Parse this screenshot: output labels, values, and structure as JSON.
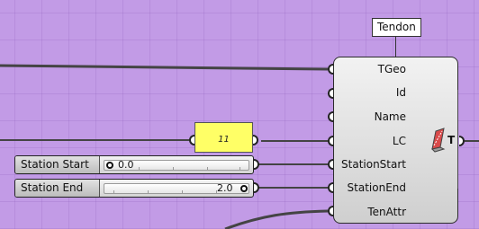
{
  "tooltip": {
    "text": "Tendon"
  },
  "component": {
    "inputs": [
      {
        "label": "TGeo"
      },
      {
        "label": "Id"
      },
      {
        "label": "Name"
      },
      {
        "label": "LC"
      },
      {
        "label": "StationStart"
      },
      {
        "label": "StationEnd"
      },
      {
        "label": "TenAttr"
      }
    ],
    "output": {
      "label": "T"
    },
    "icon": "tendon-component-icon"
  },
  "panel": {
    "value": "11"
  },
  "sliders": [
    {
      "name": "Station Start",
      "value": "0.0",
      "fraction": 0.0
    },
    {
      "name": "Station End",
      "value": "2.0",
      "fraction": 1.0
    }
  ],
  "colors": {
    "canvas": "#c29be6",
    "panel": "#ffff66",
    "wire": "#444444",
    "icon": "#d94a4a"
  }
}
